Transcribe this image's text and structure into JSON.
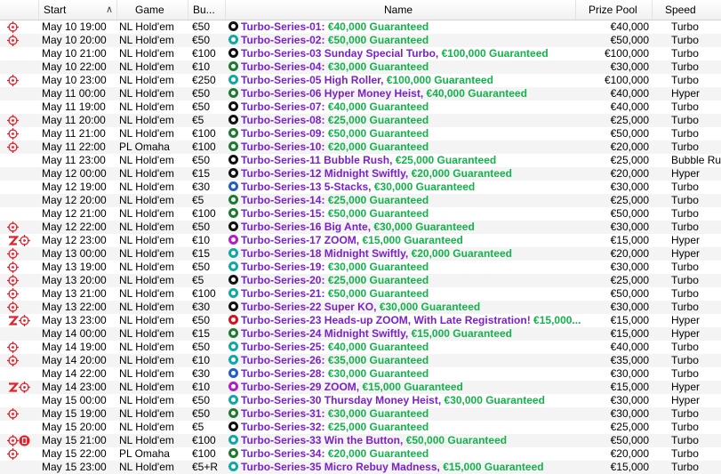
{
  "columns": {
    "start": "Start",
    "game": "Game",
    "buyin": "Bu...",
    "name": "Name",
    "prize": "Prize Pool",
    "speed": "Speed"
  },
  "colors": {
    "name_purple": "#7a21c9",
    "guarantee_green": "#12b34a",
    "ball_black": "#111111",
    "ball_teal": "#15a6a6",
    "ball_green": "#1e7a2e",
    "ball_blue": "#1f5fc4",
    "ball_magenta": "#b21fc4",
    "ball_red": "#d4141f",
    "icon_red": "#e0202a"
  },
  "rows": [
    {
      "icons": [
        "target-icon"
      ],
      "start": "May 10  19:00",
      "game": "NL Hold'em",
      "buyin": "€50",
      "ball": "black",
      "name": "Turbo-Series-01:",
      "guarantee": "€40,000 Guaranteed",
      "prize": "€40,000",
      "speed": "Turbo"
    },
    {
      "icons": [
        "target-icon"
      ],
      "start": "May 10  20:00",
      "game": "NL Hold'em",
      "buyin": "€50",
      "ball": "teal",
      "name": "Turbo-Series-02:",
      "guarantee": "€50,000 Guaranteed",
      "prize": "€50,000",
      "speed": "Turbo"
    },
    {
      "icons": [],
      "start": "May 10  21:00",
      "game": "NL Hold'em",
      "buyin": "€100",
      "ball": "black",
      "name": "Turbo-Series-03 Sunday Special Turbo,",
      "guarantee": "€100,000 Guaranteed",
      "prize": "€100,000",
      "speed": "Turbo"
    },
    {
      "icons": [],
      "start": "May 10  22:00",
      "game": "NL Hold'em",
      "buyin": "€10",
      "ball": "green",
      "name": "Turbo-Series-04:",
      "guarantee": "€30,000 Guaranteed",
      "prize": "€30,000",
      "speed": "Turbo"
    },
    {
      "icons": [
        "target-icon"
      ],
      "start": "May 10  23:00",
      "game": "NL Hold'em",
      "buyin": "€250",
      "ball": "teal",
      "name": "Turbo-Series-05 High Roller,",
      "guarantee": "€100,000 Guaranteed",
      "prize": "€100,000",
      "speed": "Turbo"
    },
    {
      "icons": [],
      "start": "May 11  00:00",
      "game": "NL Hold'em",
      "buyin": "€50",
      "ball": "green",
      "name": "Turbo-Series-06 Hyper Money Heist,",
      "guarantee": "€40,000 Guaranteed",
      "prize": "€40,000",
      "speed": "Hyper"
    },
    {
      "icons": [],
      "start": "May 11  19:00",
      "game": "NL Hold'em",
      "buyin": "€50",
      "ball": "black",
      "name": "Turbo-Series-07:",
      "guarantee": "€40,000 Guaranteed",
      "prize": "€40,000",
      "speed": "Turbo"
    },
    {
      "icons": [
        "target-icon"
      ],
      "start": "May 11  20:00",
      "game": "NL Hold'em",
      "buyin": "€5",
      "ball": "black",
      "name": "Turbo-Series-08:",
      "guarantee": "€25,000 Guaranteed",
      "prize": "€25,000",
      "speed": "Turbo"
    },
    {
      "icons": [
        "target-icon"
      ],
      "start": "May 11  21:00",
      "game": "NL Hold'em",
      "buyin": "€100",
      "ball": "green",
      "name": "Turbo-Series-09:",
      "guarantee": "€50,000 Guaranteed",
      "prize": "€50,000",
      "speed": "Turbo"
    },
    {
      "icons": [
        "target-icon"
      ],
      "start": "May 11  22:00",
      "game": "PL Omaha",
      "buyin": "€100",
      "ball": "green",
      "name": "Turbo-Series-10:",
      "guarantee": "€20,000 Guaranteed",
      "prize": "€20,000",
      "speed": "Turbo"
    },
    {
      "icons": [],
      "start": "May 11  23:00",
      "game": "NL Hold'em",
      "buyin": "€50",
      "ball": "black",
      "name": "Turbo-Series-11 Bubble Rush,",
      "guarantee": "€25,000 Guaranteed",
      "prize": "€25,000",
      "speed": "Bubble Rush"
    },
    {
      "icons": [],
      "start": "May 12  00:00",
      "game": "NL Hold'em",
      "buyin": "€15",
      "ball": "black",
      "name": "Turbo-Series-12 Midnight Swiftly,",
      "guarantee": "€20,000 Guaranteed",
      "prize": "€20,000",
      "speed": "Hyper"
    },
    {
      "icons": [],
      "start": "May 12  19:00",
      "game": "NL Hold'em",
      "buyin": "€30",
      "ball": "blue",
      "name": "Turbo-Series-13 5-Stacks,",
      "guarantee": "€30,000 Guaranteed",
      "prize": "€30,000",
      "speed": "Turbo"
    },
    {
      "icons": [],
      "start": "May 12  20:00",
      "game": "NL Hold'em",
      "buyin": "€5",
      "ball": "green",
      "name": "Turbo-Series-14:",
      "guarantee": "€25,000 Guaranteed",
      "prize": "€25,000",
      "speed": "Turbo"
    },
    {
      "icons": [],
      "start": "May 12  21:00",
      "game": "NL Hold'em",
      "buyin": "€100",
      "ball": "green",
      "name": "Turbo-Series-15:",
      "guarantee": "€50,000 Guaranteed",
      "prize": "€50,000",
      "speed": "Turbo"
    },
    {
      "icons": [
        "target-icon"
      ],
      "start": "May 12  22:00",
      "game": "NL Hold'em",
      "buyin": "€50",
      "ball": "black",
      "name": "Turbo-Series-16 Big Ante,",
      "guarantee": "€30,000 Guaranteed",
      "prize": "€30,000",
      "speed": "Turbo"
    },
    {
      "icons": [
        "zoom-icon",
        "target-icon"
      ],
      "start": "May 12  23:00",
      "game": "NL Hold'em",
      "buyin": "€10",
      "ball": "magenta",
      "name": "Turbo-Series-17 ZOOM,",
      "guarantee": "€15,000 Guaranteed",
      "prize": "€15,000",
      "speed": "Hyper"
    },
    {
      "icons": [
        "target-icon"
      ],
      "start": "May 13  00:00",
      "game": "NL Hold'em",
      "buyin": "€15",
      "ball": "teal",
      "name": "Turbo-Series-18 Midnight Swiftly,",
      "guarantee": "€20,000 Guaranteed",
      "prize": "€20,000",
      "speed": "Hyper"
    },
    {
      "icons": [
        "target-icon"
      ],
      "start": "May 13  19:00",
      "game": "NL Hold'em",
      "buyin": "€50",
      "ball": "teal",
      "name": "Turbo-Series-19:",
      "guarantee": "€30,000 Guaranteed",
      "prize": "€30,000",
      "speed": "Turbo"
    },
    {
      "icons": [
        "target-icon"
      ],
      "start": "May 13  20:00",
      "game": "NL Hold'em",
      "buyin": "€5",
      "ball": "black",
      "name": "Turbo-Series-20:",
      "guarantee": "€25,000 Guaranteed",
      "prize": "€25,000",
      "speed": "Turbo"
    },
    {
      "icons": [
        "target-icon"
      ],
      "start": "May 13  21:00",
      "game": "NL Hold'em",
      "buyin": "€100",
      "ball": "teal",
      "name": "Turbo-Series-21:",
      "guarantee": "€50,000 Guaranteed",
      "prize": "€50,000",
      "speed": "Turbo"
    },
    {
      "icons": [
        "target-icon"
      ],
      "start": "May 13  22:00",
      "game": "NL Hold'em",
      "buyin": "€30",
      "ball": "black",
      "name": "Turbo-Series-22 Super KO,",
      "guarantee": "€30,000 Guaranteed",
      "prize": "€30,000",
      "speed": "Turbo"
    },
    {
      "icons": [
        "zoom-icon",
        "target-icon"
      ],
      "start": "May 13  23:00",
      "game": "NL Hold'em",
      "buyin": "€50",
      "ball": "red",
      "name": "Turbo-Series-23 Heads-up ZOOM, With Late Registration!",
      "guarantee": "€15,000...",
      "prize": "€15,000",
      "speed": "Hyper"
    },
    {
      "icons": [],
      "start": "May 14  00:00",
      "game": "NL Hold'em",
      "buyin": "€15",
      "ball": "green",
      "name": "Turbo-Series-24 Midnight Swiftly,",
      "guarantee": "€15,000 Guaranteed",
      "prize": "€15,000",
      "speed": "Hyper"
    },
    {
      "icons": [
        "target-icon"
      ],
      "start": "May 14  19:00",
      "game": "NL Hold'em",
      "buyin": "€50",
      "ball": "teal",
      "name": "Turbo-Series-25:",
      "guarantee": "€40,000 Guaranteed",
      "prize": "€40,000",
      "speed": "Turbo"
    },
    {
      "icons": [
        "target-icon"
      ],
      "start": "May 14  20:00",
      "game": "NL Hold'em",
      "buyin": "€10",
      "ball": "teal",
      "name": "Turbo-Series-26:",
      "guarantee": "€35,000 Guaranteed",
      "prize": "€35,000",
      "speed": "Turbo"
    },
    {
      "icons": [],
      "start": "May 14  22:00",
      "game": "NL Hold'em",
      "buyin": "€30",
      "ball": "blue",
      "name": "Turbo-Series-28:",
      "guarantee": "€30,000 Guaranteed",
      "prize": "€30,000",
      "speed": "Turbo"
    },
    {
      "icons": [
        "zoom-icon",
        "target-icon"
      ],
      "start": "May 14  23:00",
      "game": "NL Hold'em",
      "buyin": "€10",
      "ball": "magenta",
      "name": "Turbo-Series-29 ZOOM,",
      "guarantee": "€15,000 Guaranteed",
      "prize": "€15,000",
      "speed": "Hyper"
    },
    {
      "icons": [],
      "start": "May 15  00:00",
      "game": "NL Hold'em",
      "buyin": "€50",
      "ball": "teal",
      "name": "Turbo-Series-30 Thursday Money Heist,",
      "guarantee": "€30,000 Guaranteed",
      "prize": "€30,000",
      "speed": "Hyper"
    },
    {
      "icons": [
        "target-icon"
      ],
      "start": "May 15  19:00",
      "game": "NL Hold'em",
      "buyin": "€50",
      "ball": "green",
      "name": "Turbo-Series-31:",
      "guarantee": "€30,000 Guaranteed",
      "prize": "€30,000",
      "speed": "Turbo"
    },
    {
      "icons": [],
      "start": "May 15  20:00",
      "game": "NL Hold'em",
      "buyin": "€5",
      "ball": "black",
      "name": "Turbo-Series-32:",
      "guarantee": "€25,000 Guaranteed",
      "prize": "€25,000",
      "speed": "Turbo"
    },
    {
      "icons": [
        "target-icon",
        "bounty-icon"
      ],
      "start": "May 15  21:00",
      "game": "NL Hold'em",
      "buyin": "€100",
      "ball": "teal",
      "name": "Turbo-Series-33 Win the Button,",
      "guarantee": "€50,000 Guaranteed",
      "prize": "€50,000",
      "speed": "Turbo"
    },
    {
      "icons": [
        "target-icon"
      ],
      "start": "May 15  22:00",
      "game": "PL Omaha",
      "buyin": "€100",
      "ball": "green",
      "name": "Turbo-Series-34:",
      "guarantee": "€20,000 Guaranteed",
      "prize": "€20,000",
      "speed": "Turbo"
    },
    {
      "icons": [],
      "start": "May 15  23:00",
      "game": "NL Hold'em",
      "buyin": "€5+R",
      "ball": "teal",
      "name": "Turbo-Series-35 Micro Rebuy Madness,",
      "guarantee": "€15,000 Guaranteed",
      "prize": "€15,000",
      "speed": "Turbo"
    }
  ]
}
